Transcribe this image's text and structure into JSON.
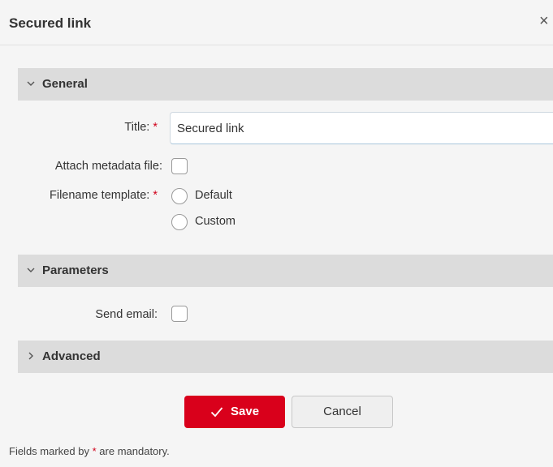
{
  "dialog": {
    "title": "Secured link",
    "close_glyph": "×"
  },
  "sections": {
    "general": {
      "label": "General",
      "expanded": true,
      "chevron": "chevron-down-icon"
    },
    "parameters": {
      "label": "Parameters",
      "expanded": true,
      "chevron": "chevron-down-icon"
    },
    "advanced": {
      "label": "Advanced",
      "expanded": false,
      "chevron": "chevron-right-icon"
    }
  },
  "general": {
    "title_label": "Title:",
    "title_value": "Secured link",
    "attach_label": "Attach metadata file:",
    "attach_checked": false,
    "filename_label": "Filename template:",
    "filename_options": [
      "Default",
      "Custom"
    ],
    "filename_selected": null
  },
  "parameters": {
    "send_email_label": "Send email:",
    "send_email_checked": false
  },
  "required_marker": "*",
  "buttons": {
    "save_label": "Save",
    "cancel_label": "Cancel"
  },
  "footer": {
    "note_before": "Fields marked by",
    "note_marker": "*",
    "note_after": "are mandatory."
  },
  "colors": {
    "accent": "#d9001b",
    "section_bar": "#dcdcdc",
    "background": "#f5f5f5"
  }
}
